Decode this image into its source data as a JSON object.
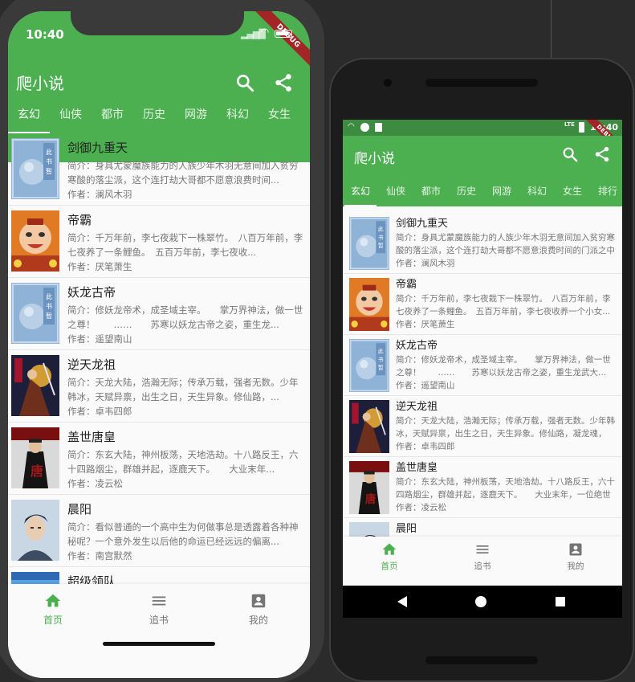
{
  "app": {
    "title": "爬小说",
    "accent_color": "#4caf50",
    "debug_label": "DEBUG"
  },
  "icons": {
    "search": "search-icon",
    "share": "share-icon",
    "home": "home-icon",
    "shelf": "list-icon",
    "profile": "account-icon"
  },
  "iphone": {
    "time": "10:40"
  },
  "android": {
    "time": "10:40",
    "lte": "LTE"
  },
  "tabs": [
    "玄幻",
    "仙侠",
    "都市",
    "历史",
    "网游",
    "科幻",
    "女生",
    "排行"
  ],
  "books": [
    {
      "title": "剑御九重天",
      "intro_iphone": "简介：身具尤蒙魔族能力的人族少年木羽无意间加入贫穷寒酸的落尘派，这个连打劫大哥都不愿意浪费时间...",
      "intro_android": "简介：身具尤蒙魔族能力的人族少年木羽无意间加入贫穷寒酸的落尘派，这个连打劫大哥都不愿意浪费时间的门派之中却...",
      "author": "作者：澜风木羽",
      "cover": "seal"
    },
    {
      "title": "帝霸",
      "intro_iphone": "简介：千万年前，李七夜栽下一株翠竹。　八百万年前，李七夜养了一条鲤鱼。　五百万年前，李七夜收...",
      "intro_android": "简介：千万年前，李七夜栽下一株翠竹。　八百万年前，李七夜养了一条鲤鱼。　五百万年前，李七夜收养一个小女...",
      "author": "作者：厌笔萧生",
      "cover": "face"
    },
    {
      "title": "妖龙古帝",
      "intro_iphone": "简介：修妖龙帝术，成圣域主宰。　　掌万界神法，做一世之尊！　　……　　苏寒以妖龙古帝之姿，重生龙...",
      "intro_android": "简介：修妖龙帝术，成圣域主宰。　　掌万界神法，做一世之尊！　　……　　苏寒以妖龙古帝之姿，重生龙武大...",
      "author": "作者：遥望南山",
      "cover": "seal"
    },
    {
      "title": "逆天龙祖",
      "intro_iphone": "简介：天龙大陆，浩瀚无际；传承万载，强者无数。少年韩冰，天赋异禀，出生之日，天生异象。修仙路，...",
      "intro_android": "简介：天龙大陆，浩瀚无际；传承万载，强者无数。少年韩冰，天赋异禀，出生之日，天生异象。修仙路，凝龙魂，与...",
      "author": "作者：卓韦四郎",
      "cover": "warrior"
    },
    {
      "title": "盖世唐皇",
      "intro_iphone": "简介：东玄大陆，神州板荡，天地浩劫。十八路反王，六十四路烟尘，群雄并起，逐鹿天下。　　大业末年...",
      "intro_android": "简介：东玄大陆，神州板荡，天地浩劫。十八路反王，六十四路烟尘，群雄并起，逐鹿天下。　　大业末年，一位绝世英...",
      "author": "作者：凌云松",
      "cover": "emperor"
    },
    {
      "title": "晨阳",
      "intro_iphone": "简介：看似普通的一个高中生为何做事总是透露着各种神秘呢？一个意外发生以后他的命运已经远远的偏离...",
      "intro_android": "",
      "author": "作者：南宫默然",
      "cover": "boy"
    },
    {
      "title": "超级领队",
      "intro_iphone": "",
      "intro_android": "",
      "author": "",
      "cover": "blue"
    }
  ],
  "bottom_nav": [
    {
      "label": "首页",
      "icon": "home-icon",
      "active": true
    },
    {
      "label": "追书",
      "icon": "list-icon",
      "active": false
    },
    {
      "label": "我的",
      "icon": "account-icon",
      "active": false
    }
  ]
}
